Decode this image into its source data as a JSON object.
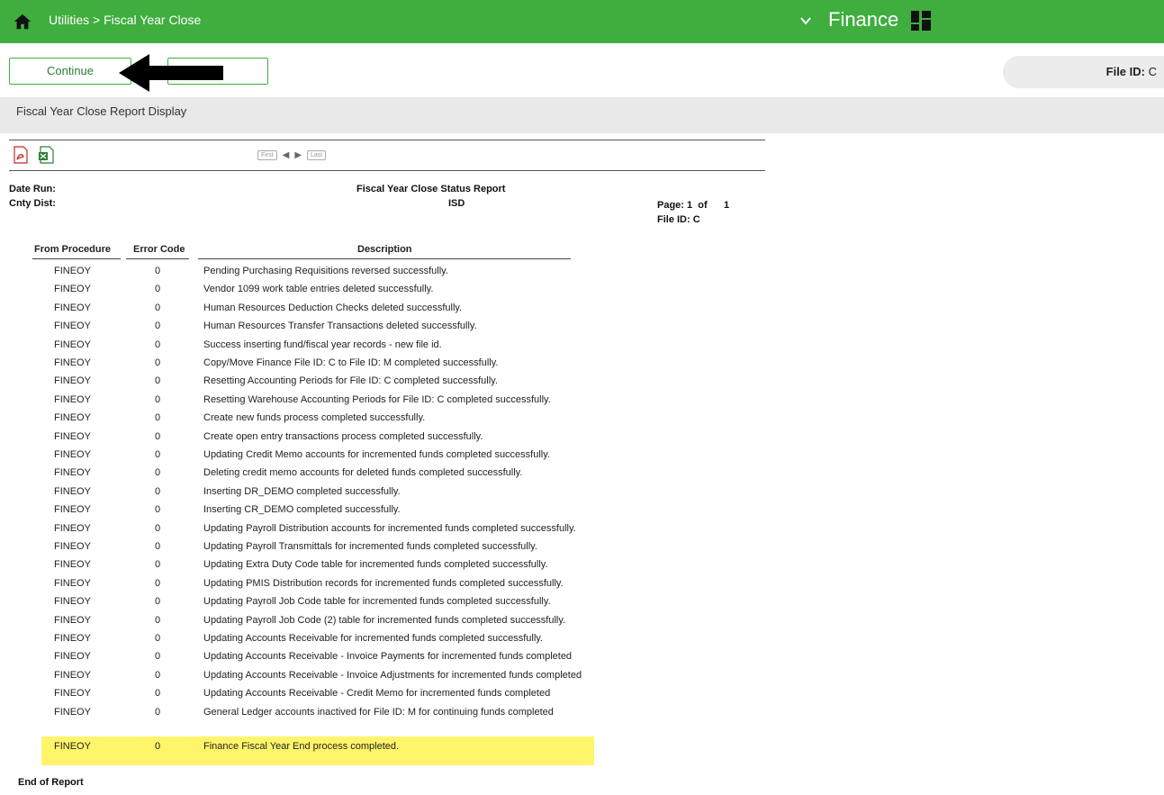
{
  "topbar": {
    "breadcrumb": "Utilities > Fiscal Year Close",
    "app_name": "Finance",
    "colors": {
      "bar": "#3fae3f"
    },
    "icons": [
      "home-icon",
      "chevron-down-icon",
      "apps-grid-icon"
    ]
  },
  "toolbar": {
    "continue_label": "Continue",
    "file_id_label": "File ID:",
    "file_id_value": "C"
  },
  "section": {
    "title": "Fiscal Year Close Report Display"
  },
  "report": {
    "icons": [
      "pdf-icon",
      "excel-icon"
    ],
    "pager": {
      "first": "First",
      "last": "Last"
    },
    "date_run_label": "Date Run:",
    "cnty_dist_label": "Cnty Dist:",
    "title": "Fiscal Year Close Status Report",
    "district": "ISD",
    "page_label": "Page: 1  of      1",
    "file_id": "File ID: C",
    "columns": {
      "proc": "From Procedure",
      "code": "Error Code",
      "desc": "Description"
    },
    "rows": [
      {
        "proc": "FINEOY",
        "code": "0",
        "desc": "Pending Purchasing Requisitions reversed successfully."
      },
      {
        "proc": "FINEOY",
        "code": "0",
        "desc": "Vendor 1099 work table entries deleted successfully."
      },
      {
        "proc": "FINEOY",
        "code": "0",
        "desc": "Human Resources Deduction Checks deleted successfully."
      },
      {
        "proc": "FINEOY",
        "code": "0",
        "desc": "Human Resources Transfer Transactions deleted successfully."
      },
      {
        "proc": "FINEOY",
        "code": "0",
        "desc": "Success inserting fund/fiscal year records - new file id."
      },
      {
        "proc": "FINEOY",
        "code": "0",
        "desc": "Copy/Move Finance File ID: C to File ID: M completed successfully."
      },
      {
        "proc": "FINEOY",
        "code": "0",
        "desc": "Resetting Accounting Periods for File ID: C completed successfully."
      },
      {
        "proc": "FINEOY",
        "code": "0",
        "desc": "Resetting Warehouse Accounting Periods for File ID: C completed successfully."
      },
      {
        "proc": "FINEOY",
        "code": "0",
        "desc": "Create new funds process completed successfully."
      },
      {
        "proc": "FINEOY",
        "code": "0",
        "desc": "Create open entry transactions process completed successfully."
      },
      {
        "proc": "FINEOY",
        "code": "0",
        "desc": "Updating Credit Memo accounts for incremented funds completed successfully."
      },
      {
        "proc": "FINEOY",
        "code": "0",
        "desc": "Deleting credit memo accounts for deleted funds completed successfully."
      },
      {
        "proc": "FINEOY",
        "code": "0",
        "desc": "Inserting DR_DEMO completed successfully."
      },
      {
        "proc": "FINEOY",
        "code": "0",
        "desc": "Inserting CR_DEMO completed successfully."
      },
      {
        "proc": "FINEOY",
        "code": "0",
        "desc": "Updating Payroll Distribution accounts for incremented funds completed successfully."
      },
      {
        "proc": "FINEOY",
        "code": "0",
        "desc": "Updating Payroll Transmittals for incremented funds completed successfully."
      },
      {
        "proc": "FINEOY",
        "code": "0",
        "desc": "Updating Extra Duty Code table for incremented funds completed successfully."
      },
      {
        "proc": "FINEOY",
        "code": "0",
        "desc": "Updating PMIS Distribution records for incremented funds completed successfully."
      },
      {
        "proc": "FINEOY",
        "code": "0",
        "desc": "Updating Payroll Job Code table for incremented funds completed successfully."
      },
      {
        "proc": "FINEOY",
        "code": "0",
        "desc": "Updating Payroll Job Code (2) table for incremented funds completed successfully."
      },
      {
        "proc": "FINEOY",
        "code": "0",
        "desc": "Updating Accounts Receivable for incremented funds completed successfully."
      },
      {
        "proc": "FINEOY",
        "code": "0",
        "desc": "Updating Accounts Receivable - Invoice Payments for incremented funds completed"
      },
      {
        "proc": "FINEOY",
        "code": "0",
        "desc": "Updating Accounts Receivable - Invoice Adjustments for incremented funds completed"
      },
      {
        "proc": "FINEOY",
        "code": "0",
        "desc": "Updating Accounts Receivable - Credit Memo for incremented funds completed"
      },
      {
        "proc": "FINEOY",
        "code": "0",
        "desc": "General Ledger accounts inactived for File ID: M for continuing funds completed"
      },
      {
        "proc": "FINEOY",
        "code": "0",
        "desc": "Finance Fiscal Year End process completed."
      }
    ],
    "highlight_color": "#fff56a",
    "end_label": "End of Report"
  }
}
